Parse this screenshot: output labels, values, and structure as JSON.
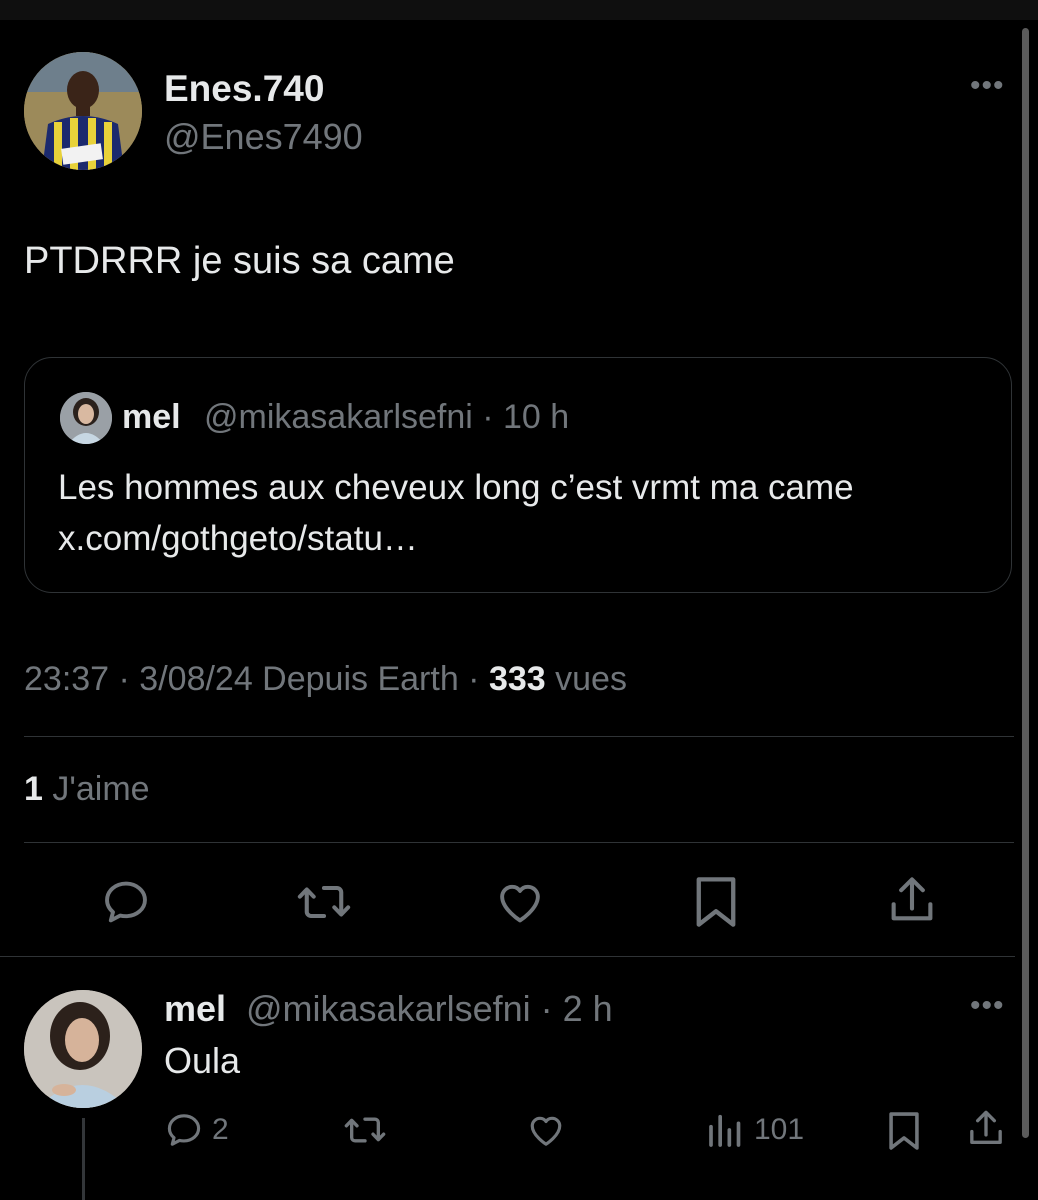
{
  "tweet": {
    "display_name": "Enes.740",
    "handle": "@Enes7490",
    "text": "PTDRRR je suis sa came",
    "avatar_icon": "footballer-avatar",
    "more_icon": "•••",
    "quote": {
      "display_name": "mel",
      "meta": "@mikasakarlsefni · 10 h",
      "text_line1": "Les hommes aux cheveux long c’est vrmt ma came",
      "text_line2": "x.com/gothgeto/statu…",
      "avatar_icon": "woman-avatar"
    },
    "timestamp": "23:37 · 3/08/24 Depuis Earth · ",
    "views_count": "333",
    "views_label": " vues",
    "likes_count": "1",
    "likes_label": " J'aime",
    "actions": [
      "reply-icon",
      "retweet-icon",
      "like-icon",
      "bookmark-icon",
      "share-icon"
    ]
  },
  "reply": {
    "display_name": "mel",
    "meta": "@mikasakarlsefni · 2 h",
    "text": "Oula",
    "avatar_icon": "woman-avatar",
    "more_icon": "•••",
    "reply_count": "2",
    "views_count": "101",
    "actions": [
      "reply-icon",
      "retweet-icon",
      "like-icon",
      "views-icon",
      "bookmark-icon",
      "share-icon"
    ]
  },
  "colors": {
    "background": "#000000",
    "text_primary": "#e7e9ea",
    "text_secondary": "#71767b",
    "border": "#2f3336"
  }
}
